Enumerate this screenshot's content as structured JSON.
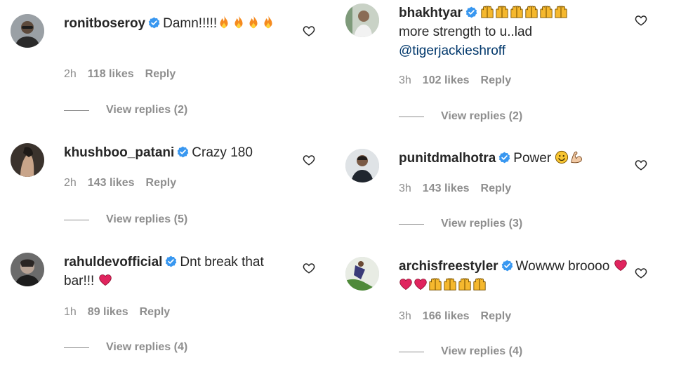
{
  "comments": [
    {
      "username": "ronitboseroy",
      "text": "Damn!!!!!",
      "emojis": [
        "fire",
        "fire",
        "fire",
        "fire"
      ],
      "time": "2h",
      "likes": "118 likes",
      "reply": "Reply",
      "view_replies": "View replies (2)"
    },
    {
      "username": "khushboo_patani",
      "text": "Crazy 180",
      "time": "2h",
      "likes": "143 likes",
      "reply": "Reply",
      "view_replies": "View replies (5)"
    },
    {
      "username": "rahuldevofficial",
      "text": "Dnt break that bar!!!",
      "emojis": [
        "red-heart"
      ],
      "time": "1h",
      "likes": "89 likes",
      "reply": "Reply",
      "view_replies": "View replies (4)"
    },
    {
      "username": "bhakhtyar",
      "text": "more strength to u..lad",
      "mention": "@tigerjackieshroff",
      "emojis": [
        "raising-hands",
        "raising-hands",
        "raising-hands",
        "raising-hands",
        "raising-hands",
        "raising-hands"
      ],
      "time": "3h",
      "likes": "102 likes",
      "reply": "Reply",
      "view_replies": "View replies (2)"
    },
    {
      "username": "punitdmalhotra",
      "text": "Power",
      "emojis": [
        "smiley",
        "flexed-biceps"
      ],
      "time": "3h",
      "likes": "143 likes",
      "reply": "Reply",
      "view_replies": "View replies (3)"
    },
    {
      "username": "archisfreestyler",
      "text": "Wowww broooo",
      "emojis": [
        "red-heart",
        "red-heart",
        "red-heart",
        "raising-hands",
        "raising-hands",
        "raising-hands",
        "raising-hands"
      ],
      "time": "3h",
      "likes": "166 likes",
      "reply": "Reply",
      "view_replies": "View replies (4)"
    }
  ],
  "colors": {
    "verified": "#3897f0",
    "mention": "#00376b",
    "meta": "#8e8e8e",
    "heart-emoji": "#e0245e",
    "fire": "#f58a1f",
    "hands": "#f5b82e"
  },
  "icons": {
    "like": "heart-outline-icon",
    "verified": "verified-badge-icon"
  }
}
